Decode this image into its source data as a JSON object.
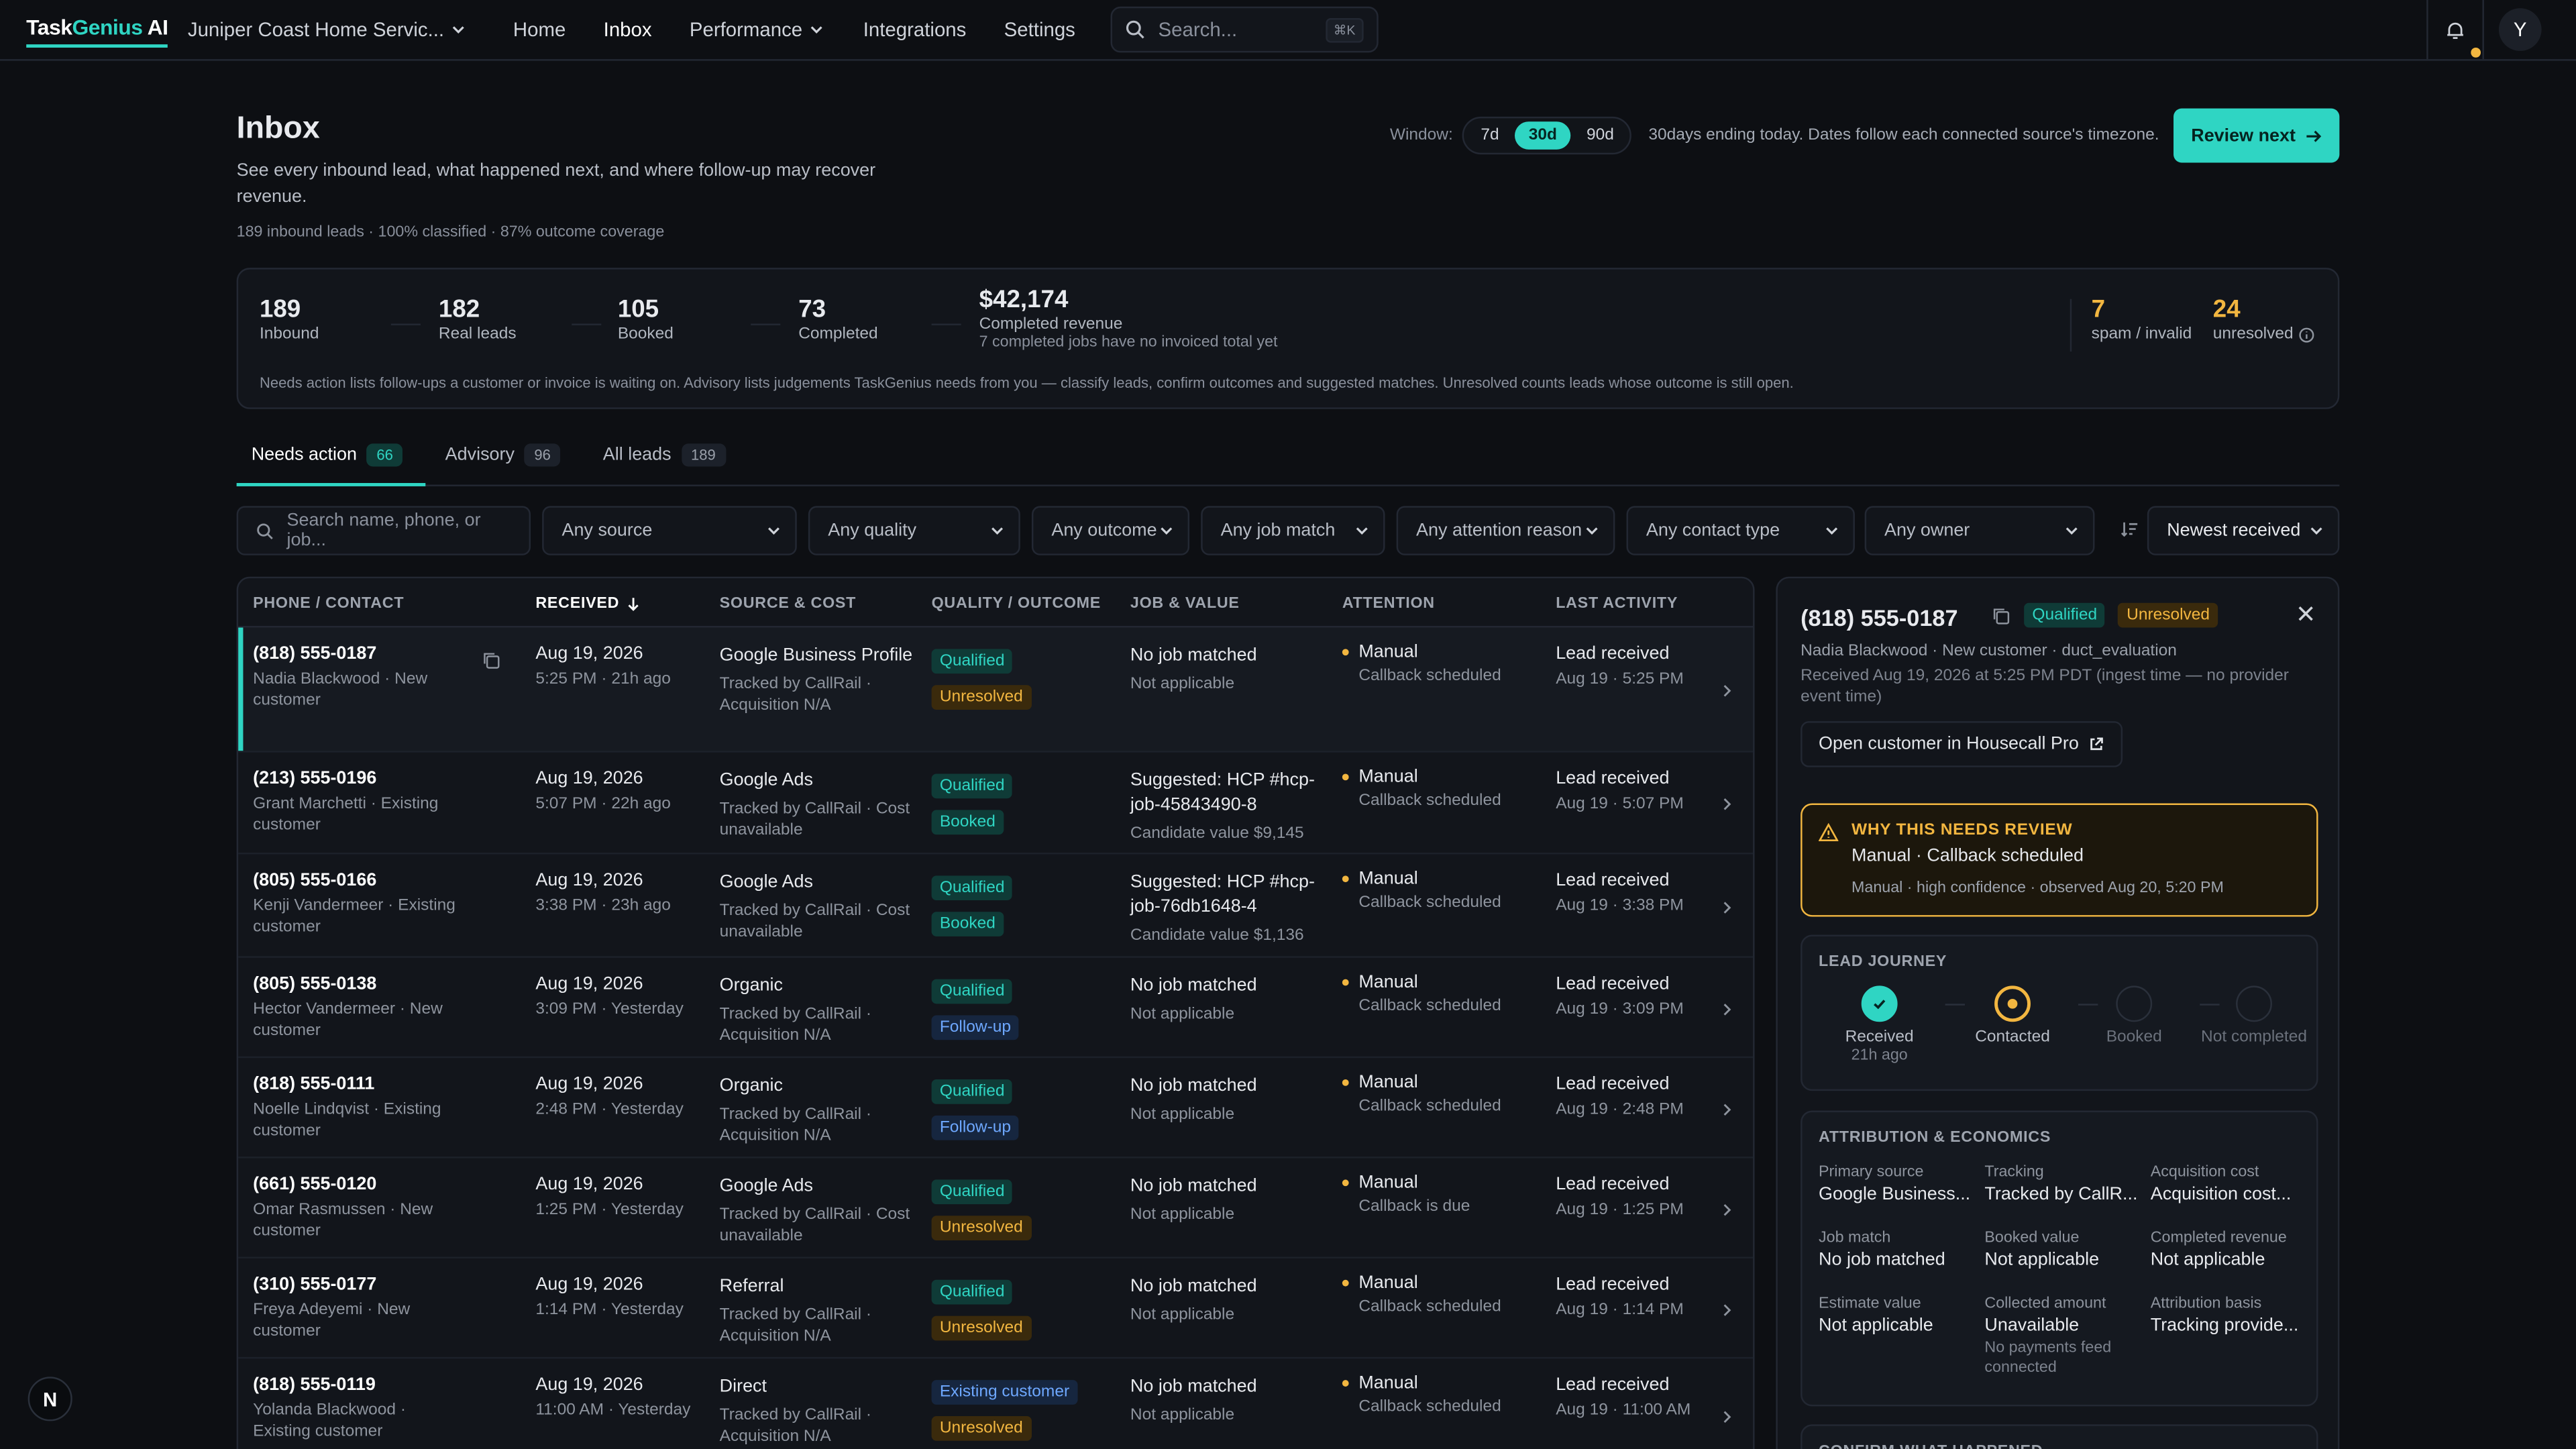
{
  "nav": {
    "brand_main": "Task",
    "brand_accent": "Genius",
    "brand_suffix": " AI",
    "org": "Juniper Coast Home Servic...",
    "items": [
      "Home",
      "Inbox",
      "Performance",
      "Integrations",
      "Settings"
    ],
    "search_placeholder": "Search...",
    "search_kbd": "⌘K",
    "avatar": "Y"
  },
  "header": {
    "title": "Inbox",
    "subtitle": "See every inbound lead, what happened next, and where follow-up may recover revenue.",
    "meta": "189 inbound leads · 100% classified · 87% outcome coverage",
    "window_label": "Window:",
    "windows": [
      "7d",
      "30d",
      "90d"
    ],
    "window_selected": "30d",
    "window_text": "30days ending today. Dates follow each connected source's timezone.",
    "review_button": "Review next"
  },
  "stats": {
    "items": [
      {
        "value": "189",
        "label": "Inbound"
      },
      {
        "value": "182",
        "label": "Real leads"
      },
      {
        "value": "105",
        "label": "Booked"
      },
      {
        "value": "73",
        "label": "Completed"
      },
      {
        "value": "$42,174",
        "label": "Completed revenue",
        "sublabel": "7 completed jobs have no invoiced total yet"
      }
    ],
    "spam": {
      "value": "7",
      "label": "spam / invalid"
    },
    "unresolved": {
      "value": "24",
      "label": "unresolved"
    },
    "note": "Needs action lists follow-ups a customer or invoice is waiting on. Advisory lists judgements TaskGenius needs from you — classify leads, confirm outcomes and suggested matches. Unresolved counts leads whose outcome is still open."
  },
  "tabs": [
    {
      "label": "Needs action",
      "count": "66"
    },
    {
      "label": "Advisory",
      "count": "96"
    },
    {
      "label": "All leads",
      "count": "189"
    }
  ],
  "filters": {
    "search_placeholder": "Search name, phone, or job...",
    "selects": [
      "Any source",
      "Any quality",
      "Any outcome",
      "Any job match",
      "Any attention reason",
      "Any contact type",
      "Any owner"
    ],
    "sort": "Newest received"
  },
  "table": {
    "headers": [
      "PHONE / CONTACT",
      "RECEIVED",
      "SOURCE & COST",
      "QUALITY / OUTCOME",
      "JOB & VALUE",
      "ATTENTION",
      "LAST ACTIVITY"
    ],
    "rows": [
      {
        "phone": "(818) 555-0187",
        "contact": "Nadia Blackwood · New customer",
        "date": "Aug 19, 2026",
        "time": "5:25 PM · 21h ago",
        "source": "Google Business Profile",
        "cost": "Tracked by CallRail · Acquisition N/A",
        "quality": "Qualified",
        "outcome": "Unresolved",
        "job": "No job matched",
        "job_sub": "Not applicable",
        "job_val": "",
        "att": "Manual",
        "att_sub": "Callback scheduled",
        "act": "Lead received",
        "act_sub": "Aug 19 · 5:25 PM"
      },
      {
        "phone": "(213) 555-0196",
        "contact": "Grant Marchetti · Existing customer",
        "date": "Aug 19, 2026",
        "time": "5:07 PM · 22h ago",
        "source": "Google Ads",
        "cost": "Tracked by CallRail · Cost unavailable",
        "quality": "Qualified",
        "outcome": "Booked",
        "job": "Suggested: HCP #hcp-job-45843490-8",
        "job_sub": "",
        "job_val": "Candidate value $9,145",
        "att": "Manual",
        "att_sub": "Callback scheduled",
        "act": "Lead received",
        "act_sub": "Aug 19 · 5:07 PM"
      },
      {
        "phone": "(805) 555-0166",
        "contact": "Kenji Vandermeer · Existing customer",
        "date": "Aug 19, 2026",
        "time": "3:38 PM · 23h ago",
        "source": "Google Ads",
        "cost": "Tracked by CallRail · Cost unavailable",
        "quality": "Qualified",
        "outcome": "Booked",
        "job": "Suggested: HCP #hcp-job-76db1648-4",
        "job_sub": "",
        "job_val": "Candidate value $1,136",
        "att": "Manual",
        "att_sub": "Callback scheduled",
        "act": "Lead received",
        "act_sub": "Aug 19 · 3:38 PM"
      },
      {
        "phone": "(805) 555-0138",
        "contact": "Hector Vandermeer · New customer",
        "date": "Aug 19, 2026",
        "time": "3:09 PM · Yesterday",
        "source": "Organic",
        "cost": "Tracked by CallRail · Acquisition N/A",
        "quality": "Qualified",
        "outcome": "Follow-up",
        "job": "No job matched",
        "job_sub": "Not applicable",
        "job_val": "",
        "att": "Manual",
        "att_sub": "Callback scheduled",
        "act": "Lead received",
        "act_sub": "Aug 19 · 3:09 PM"
      },
      {
        "phone": "(818) 555-0111",
        "contact": "Noelle Lindqvist · Existing customer",
        "date": "Aug 19, 2026",
        "time": "2:48 PM · Yesterday",
        "source": "Organic",
        "cost": "Tracked by CallRail · Acquisition N/A",
        "quality": "Qualified",
        "outcome": "Follow-up",
        "job": "No job matched",
        "job_sub": "Not applicable",
        "job_val": "",
        "att": "Manual",
        "att_sub": "Callback scheduled",
        "act": "Lead received",
        "act_sub": "Aug 19 · 2:48 PM"
      },
      {
        "phone": "(661) 555-0120",
        "contact": "Omar Rasmussen · New customer",
        "date": "Aug 19, 2026",
        "time": "1:25 PM · Yesterday",
        "source": "Google Ads",
        "cost": "Tracked by CallRail · Cost unavailable",
        "quality": "Qualified",
        "outcome": "Unresolved",
        "job": "No job matched",
        "job_sub": "Not applicable",
        "job_val": "",
        "att": "Manual",
        "att_sub": "Callback is due",
        "act": "Lead received",
        "act_sub": "Aug 19 · 1:25 PM"
      },
      {
        "phone": "(310) 555-0177",
        "contact": "Freya Adeyemi · New customer",
        "date": "Aug 19, 2026",
        "time": "1:14 PM · Yesterday",
        "source": "Referral",
        "cost": "Tracked by CallRail · Acquisition N/A",
        "quality": "Qualified",
        "outcome": "Unresolved",
        "job": "No job matched",
        "job_sub": "Not applicable",
        "job_val": "",
        "att": "Manual",
        "att_sub": "Callback scheduled",
        "act": "Lead received",
        "act_sub": "Aug 19 · 1:14 PM"
      },
      {
        "phone": "(818) 555-0119",
        "contact": "Yolanda Blackwood · Existing customer",
        "date": "Aug 19, 2026",
        "time": "11:00 AM · Yesterday",
        "source": "Direct",
        "cost": "Tracked by CallRail · Acquisition N/A",
        "quality": "Existing customer",
        "outcome": "Unresolved",
        "job": "No job matched",
        "job_sub": "Not applicable",
        "job_val": "",
        "att": "Manual",
        "att_sub": "Callback scheduled",
        "act": "Lead received",
        "act_sub": "Aug 19 · 11:00 AM"
      }
    ]
  },
  "detail": {
    "phone": "(818) 555-0187",
    "badge_quality": "Qualified",
    "badge_outcome": "Unresolved",
    "line1": "Nadia Blackwood · New customer · duct_evaluation",
    "line2": "Received Aug 19, 2026 at 5:25 PM PDT (ingest time — no provider event time)",
    "open_button": "Open customer in Housecall Pro",
    "why_title": "WHY THIS NEEDS REVIEW",
    "why_reason": "Manual · Callback scheduled",
    "why_meta": "Manual · high confidence · observed Aug 20, 5:20 PM",
    "journey_title": "LEAD JOURNEY",
    "journey": [
      {
        "label": "Received",
        "sub": "21h ago"
      },
      {
        "label": "Contacted",
        "sub": ""
      },
      {
        "label": "Booked",
        "sub": ""
      },
      {
        "label": "Not completed",
        "sub": ""
      }
    ],
    "attr_title": "ATTRIBUTION & ECONOMICS",
    "attr": [
      {
        "k": "Primary source",
        "v": "Google Business..."
      },
      {
        "k": "Tracking",
        "v": "Tracked by CallR..."
      },
      {
        "k": "Acquisition cost",
        "v": "Acquisition cost..."
      },
      {
        "k": "Job match",
        "v": "No job matched"
      },
      {
        "k": "Booked value",
        "v": "Not applicable"
      },
      {
        "k": "Completed revenue",
        "v": "Not applicable"
      },
      {
        "k": "Estimate value",
        "v": "Not applicable"
      },
      {
        "k": "Collected amount",
        "v": "Unavailable",
        "n": "No payments feed connected"
      },
      {
        "k": "Attribution basis",
        "v": "Tracking provide..."
      }
    ],
    "confirm_title": "CONFIRM WHAT HAPPENED"
  },
  "corner_badge": "N",
  "colors": {
    "accent": "#2fd5c3",
    "warning": "#f2b640",
    "info": "#6ea8ff"
  }
}
